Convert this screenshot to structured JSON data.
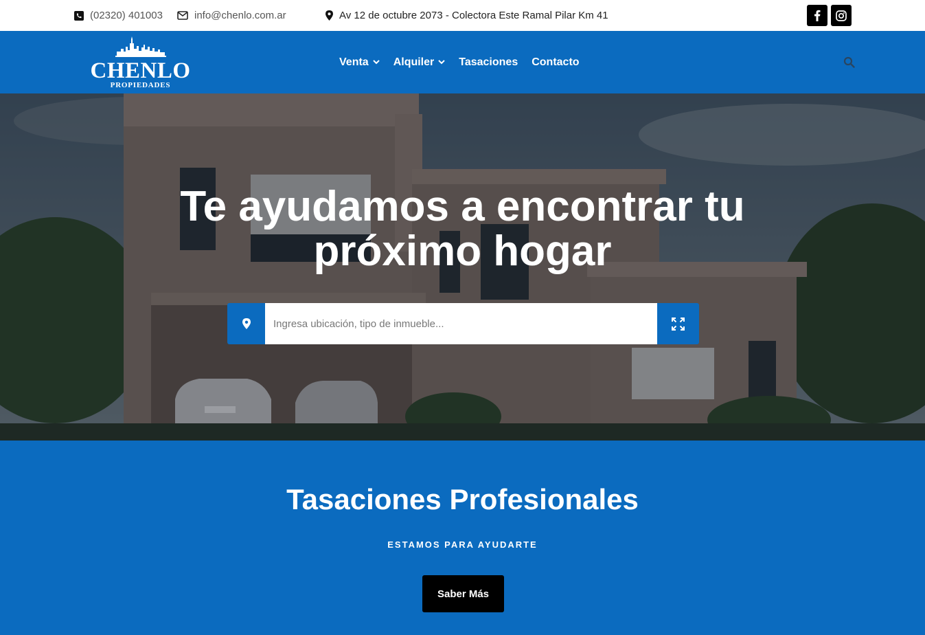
{
  "topbar": {
    "phone": "(02320) 401003",
    "email": "info@chenlo.com.ar",
    "address": "Av 12 de octubre 2073 - Colectora Este Ramal Pilar Km 41",
    "social": [
      "facebook-icon",
      "instagram-icon"
    ]
  },
  "nav": {
    "logo": {
      "word": "CHENLO",
      "sub": "PROPIEDADES"
    },
    "items": [
      {
        "label": "Venta",
        "has_dropdown": true
      },
      {
        "label": "Alquiler",
        "has_dropdown": true
      },
      {
        "label": "Tasaciones",
        "has_dropdown": false
      },
      {
        "label": "Contacto",
        "has_dropdown": false
      }
    ],
    "search_icon": "search-icon"
  },
  "hero": {
    "title_line1": "Te ayudamos a encontrar tu",
    "title_line2": "próximo hogar",
    "search": {
      "placeholder": "Ingresa ubicación, tipo de inmueble...",
      "value": ""
    }
  },
  "tasaciones": {
    "title": "Tasaciones Profesionales",
    "subtitle": "ESTAMOS PARA AYUDARTE",
    "button": "Saber Más"
  },
  "colors": {
    "brand_blue": "#0b6bbf",
    "button_black": "#000000",
    "white": "#ffffff"
  }
}
